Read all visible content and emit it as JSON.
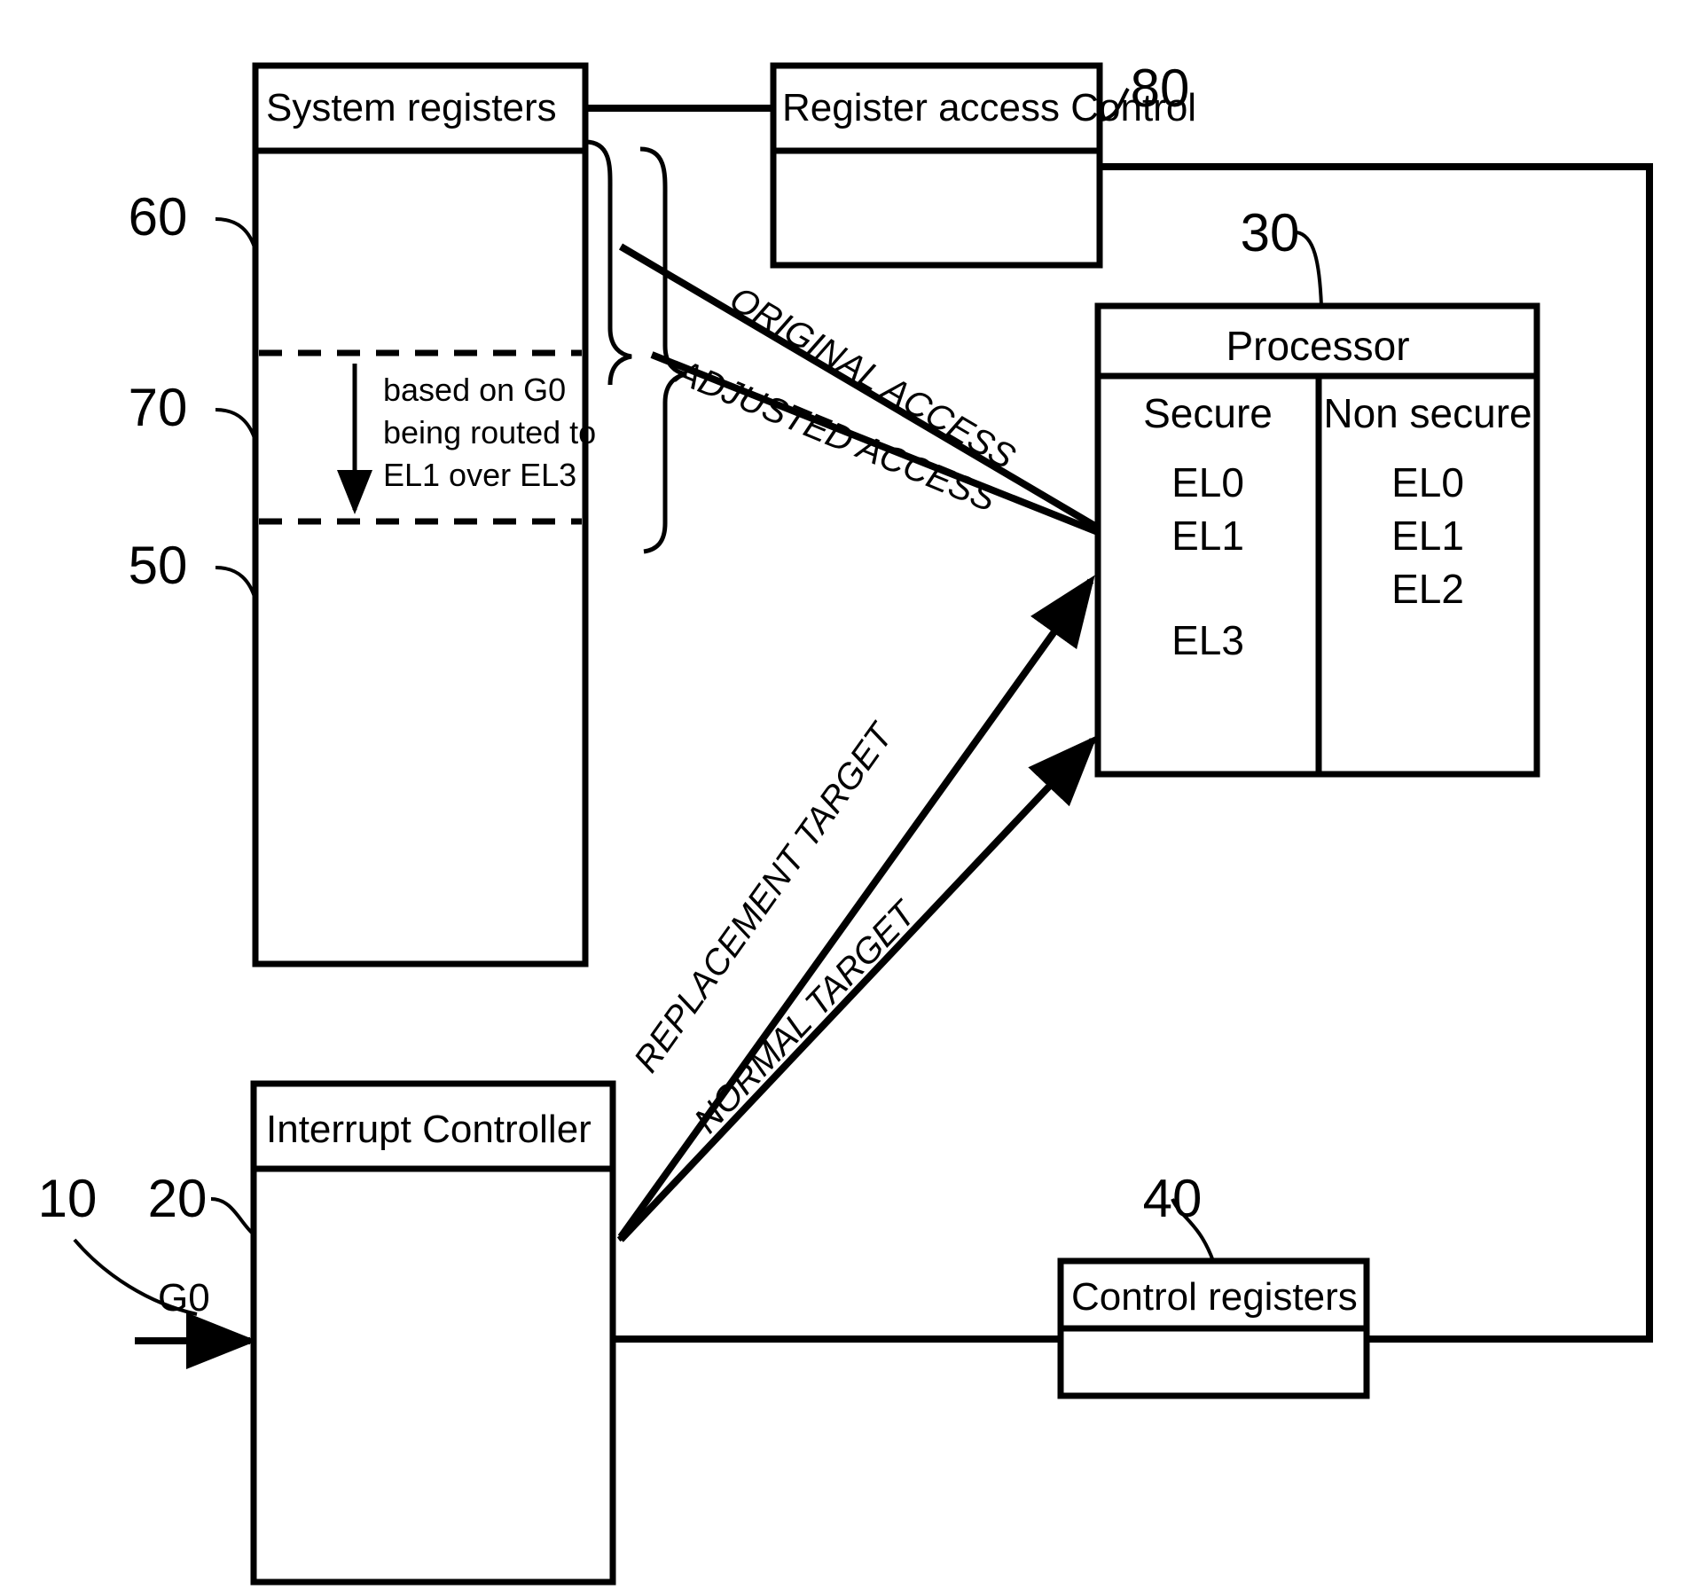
{
  "figure": {
    "type": "patent-block-diagram",
    "title": "Interrupt routing and register access control block diagram"
  },
  "boxes": {
    "system_registers": {
      "label": "System registers",
      "ref": "60",
      "regions": [
        {
          "ref": "70",
          "note_lines": [
            "based on G0",
            "being routed to",
            "EL1 over EL3"
          ]
        },
        {
          "ref": "50"
        }
      ]
    },
    "register_access_control": {
      "label": "Register access Control",
      "ref": "80"
    },
    "processor": {
      "label": "Processor",
      "ref": "30",
      "columns": [
        {
          "header": "Secure",
          "levels": [
            "EL0",
            "EL1",
            "",
            "EL3"
          ]
        },
        {
          "header": "Non secure",
          "levels": [
            "EL0",
            "EL1",
            "EL2"
          ]
        }
      ]
    },
    "interrupt_controller": {
      "label": "Interrupt Controller",
      "ref": "20"
    },
    "control_registers": {
      "label": "Control registers",
      "ref": "40"
    }
  },
  "refs": {
    "system": "10",
    "interrupt_controller": "20",
    "processor": "30",
    "control_registers": "40",
    "system_registers_lower": "50",
    "system_registers": "60",
    "system_registers_mid": "70",
    "register_access_control": "80"
  },
  "signals": {
    "input": "G0"
  },
  "edge_labels": {
    "original_access": "ORIGINAL ACCESS",
    "adjusted_access": "ADJUSTED ACCESS",
    "replacement_target": "REPLACEMENT TARGET",
    "normal_target": "NORMAL TARGET"
  },
  "colors": {
    "stroke": "#000000",
    "fill": "#ffffff"
  }
}
